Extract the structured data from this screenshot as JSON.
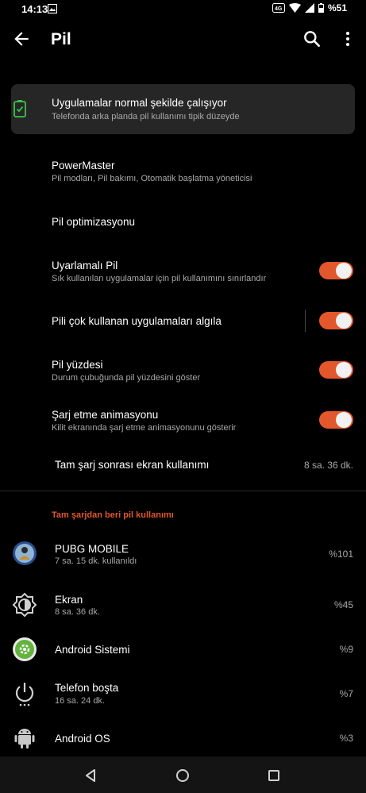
{
  "status": {
    "time": "14:13",
    "battery_text": "%51"
  },
  "appbar": {
    "title": "Pil"
  },
  "status_card": {
    "title": "Uygulamalar normal şekilde çalışıyor",
    "subtitle": "Telefonda arka planda pil kullanımı tipik düzeyde"
  },
  "powermaster": {
    "title": "PowerMaster",
    "subtitle": "Pil modları, Pil bakımı, Otomatik başlatma yöneticisi"
  },
  "optimization": {
    "title": "Pil optimizasyonu"
  },
  "adaptive": {
    "title": "Uyarlamalı Pil",
    "subtitle": "Sık kullanılan uygulamalar için pil kullanımını sınırlandır",
    "on": true
  },
  "detect": {
    "title": "Pili çok kullanan uygulamaları algıla",
    "on": true
  },
  "percentage": {
    "title": "Pil yüzdesi",
    "subtitle": "Durum çubuğunda pil yüzdesini göster",
    "on": true
  },
  "animation": {
    "title": "Şarj etme animasyonu",
    "subtitle": "Kilit ekranında şarj etme animasyonunu gösterir",
    "on": true
  },
  "screen_usage": {
    "title": "Tam şarj sonrası ekran kullanımı",
    "value": "8 sa. 36 dk."
  },
  "usage_header": "Tam şarjdan beri pil kullanımı",
  "usage": [
    {
      "name": "PUBG MOBILE",
      "sub": "7 sa. 15 dk. kullanıldı",
      "value": "%101",
      "icon": "pubg-icon"
    },
    {
      "name": "Ekran",
      "sub": "8 sa. 36 dk.",
      "value": "%45",
      "icon": "brightness-icon"
    },
    {
      "name": "Android Sistemi",
      "sub": "",
      "value": "%9",
      "icon": "android-system-icon"
    },
    {
      "name": "Telefon boşta",
      "sub": "16 sa. 24 dk.",
      "value": "%7",
      "icon": "power-icon"
    },
    {
      "name": "Android OS",
      "sub": "",
      "value": "%3",
      "icon": "android-icon"
    }
  ],
  "colors": {
    "accent": "#e2572b",
    "card": "#262626",
    "battery_green": "#3ec24a"
  }
}
